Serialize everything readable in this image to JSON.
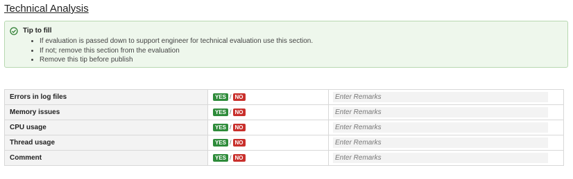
{
  "page": {
    "title": "Technical Analysis"
  },
  "tip": {
    "title": "Tip to fill",
    "items": [
      "If evaluation is passed down to support engineer for technical evaluation use this section.",
      "If not; remove this section from the evaluation",
      "Remove this tip before publish"
    ]
  },
  "table": {
    "rows": [
      {
        "label": "Errors in log  files",
        "yes": "YES",
        "sep": "/",
        "no": "NO",
        "placeholder": "Enter Remarks"
      },
      {
        "label": "Memory issues",
        "yes": "YES",
        "sep": "/",
        "no": "NO",
        "placeholder": "Enter Remarks"
      },
      {
        "label": "CPU usage",
        "yes": "YES",
        "sep": "/",
        "no": "NO",
        "placeholder": "Enter Remarks"
      },
      {
        "label": "Thread usage",
        "yes": "YES",
        "sep": "/",
        "no": "NO",
        "placeholder": "Enter Remarks"
      },
      {
        "label": "Comment",
        "yes": "YES",
        "sep": "/",
        "no": "NO",
        "placeholder": "Enter Remarks"
      }
    ]
  },
  "colors": {
    "yes": "#2e8b3a",
    "no": "#c9302c",
    "tip_bg": "#eef7ec",
    "tip_border": "#b7d8b0"
  }
}
